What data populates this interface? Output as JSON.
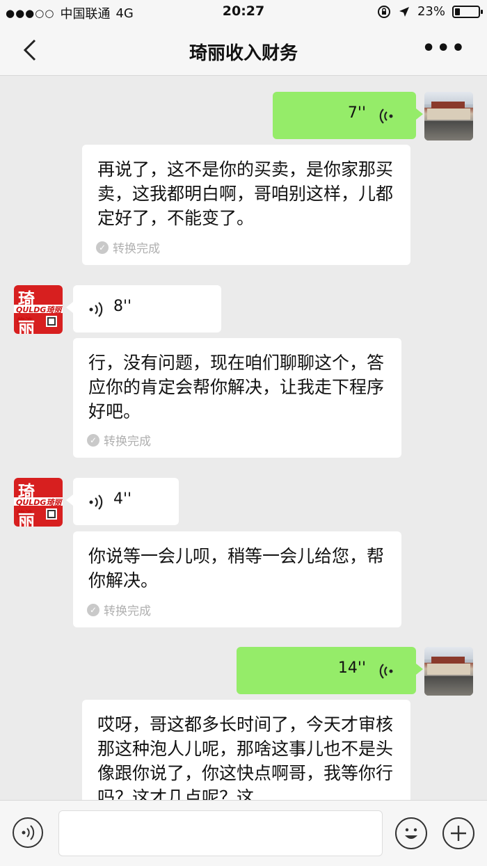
{
  "status_bar": {
    "signal": "●●●○○",
    "carrier": "中国联通",
    "network": "4G",
    "time": "20:27",
    "battery_text": "23%",
    "battery_level": 0.23
  },
  "nav": {
    "title": "琦丽收入财务"
  },
  "brand_avatar": {
    "char1": "琦",
    "char2": "丽",
    "logo": "QULDG琦丽物流"
  },
  "messages": [
    {
      "side": "out",
      "duration": "7''",
      "transcript": "再说了，这不是你的买卖，是你家那买卖，这我都明白啊，哥咱别这样，儿都定好了，不能变了。",
      "status": "转换完成"
    },
    {
      "side": "in",
      "duration": "8''",
      "transcript": "行，没有问题，现在咱们聊聊这个，答应你的肯定会帮你解决，让我走下程序好吧。",
      "status": "转换完成"
    },
    {
      "side": "in",
      "duration": "4''",
      "transcript": "你说等一会儿呗，稍等一会儿给您，帮你解决。",
      "status": "转换完成"
    },
    {
      "side": "out",
      "duration": "14''",
      "transcript": "哎呀，哥这都多长时间了，今天才审核那这种泡人儿呢，那啥这事儿也不是头像跟你说了，你这快点啊哥，我等你行吗？这才几点呢？这",
      "status": ""
    }
  ],
  "input": {
    "placeholder": ""
  }
}
